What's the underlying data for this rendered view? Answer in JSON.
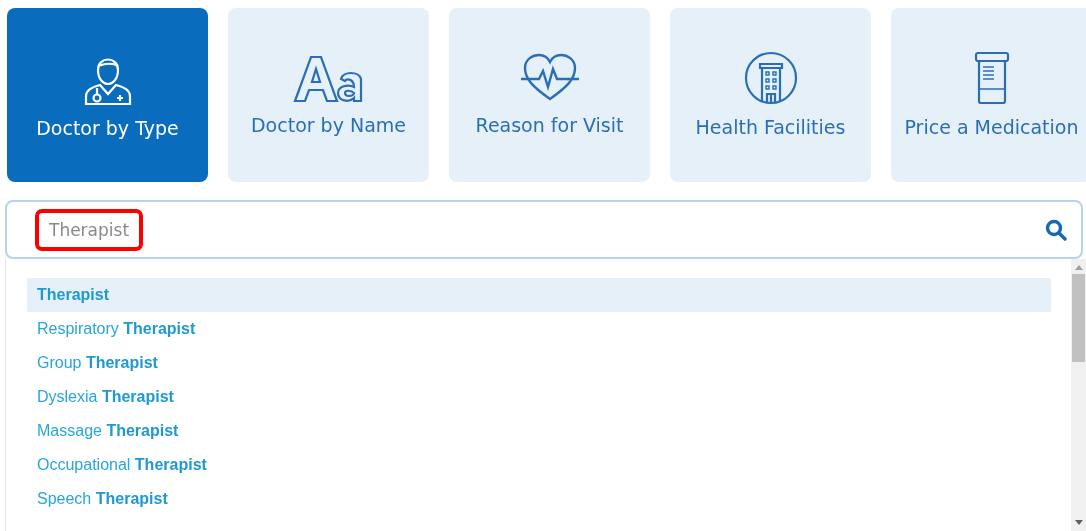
{
  "tabs": [
    {
      "label": "Doctor by Type",
      "kind": "doctor",
      "selected": true
    },
    {
      "label": "Doctor by Name",
      "kind": "letters",
      "selected": false
    },
    {
      "label": "Reason for Visit",
      "kind": "heart",
      "selected": false
    },
    {
      "label": "Health Facilities",
      "kind": "building",
      "selected": false
    },
    {
      "label": "Price a Medication",
      "kind": "bottle",
      "selected": false
    }
  ],
  "search": {
    "value": "Therapist",
    "highlighted": true
  },
  "suggestions": [
    {
      "match": "Therapist",
      "selected": true
    },
    {
      "prefix": "Respiratory",
      "match": "Therapist",
      "selected": false
    },
    {
      "prefix": "Group",
      "match": "Therapist",
      "selected": false
    },
    {
      "prefix": "Dyslexia",
      "match": "Therapist",
      "selected": false
    },
    {
      "prefix": "Massage",
      "match": "Therapist",
      "selected": false
    },
    {
      "prefix": "Occupational",
      "match": "Therapist",
      "selected": false
    },
    {
      "prefix": "Speech",
      "match": "Therapist",
      "selected": false
    }
  ]
}
